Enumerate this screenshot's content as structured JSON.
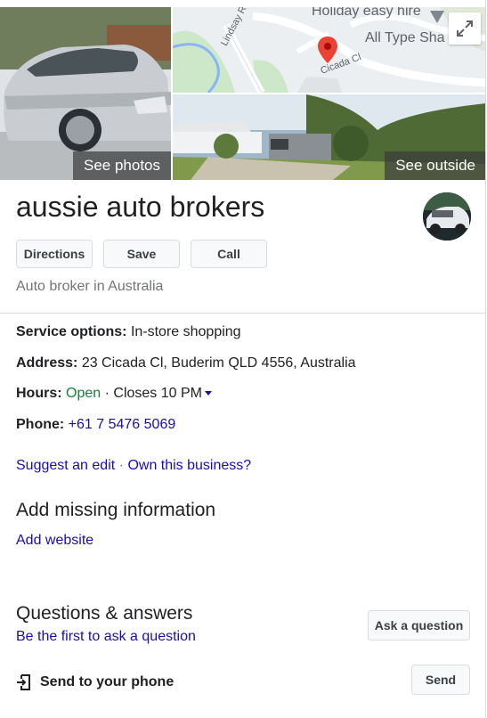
{
  "photos": {
    "see_photos_label": "See photos",
    "see_outside_label": "See outside"
  },
  "map": {
    "business_label": "Holiday easy hire",
    "nearby_label": "All Type Sha",
    "road_1": "Lindsay Rd",
    "road_2": "Cicada Cl"
  },
  "business": {
    "name": "aussie auto brokers",
    "category": "Auto broker in Australia"
  },
  "actions": {
    "directions": "Directions",
    "save": "Save",
    "call": "Call"
  },
  "details": {
    "service_label": "Service options:",
    "service_value": "In-store shopping",
    "address_label": "Address:",
    "address_value": "23 Cicada Cl, Buderim QLD 4556, Australia",
    "hours_label": "Hours:",
    "hours_status": "Open",
    "hours_sep": "·",
    "hours_close": "Closes 10 PM",
    "phone_label": "Phone:",
    "phone_value": "+61 7 5476 5069"
  },
  "edit_links": {
    "suggest": "Suggest an edit",
    "sep": "·",
    "own": "Own this business?"
  },
  "missing": {
    "title": "Add missing information",
    "add_website": "Add website"
  },
  "qa": {
    "title": "Questions & answers",
    "first_link": "Be the first to ask a question",
    "ask_button": "Ask a question"
  },
  "send": {
    "label": "Send to your phone",
    "button": "Send"
  },
  "colors": {
    "link": "#1a0dab",
    "open": "#188038",
    "pin": "#ea4335"
  }
}
